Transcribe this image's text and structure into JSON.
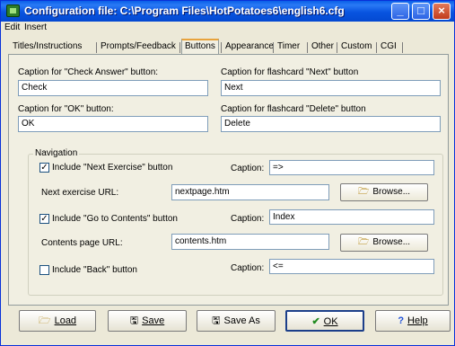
{
  "window": {
    "title": "Configuration file: C:\\Program Files\\HotPotatoes6\\english6.cfg",
    "minimize_glyph": "_",
    "maximize_glyph": "□",
    "close_glyph": "×"
  },
  "menu": {
    "items": [
      "Edit",
      "Insert"
    ]
  },
  "tabs": [
    "Titles/Instructions",
    "Prompts/Feedback",
    "Buttons",
    "Appearance",
    "Timer",
    "Other",
    "Custom",
    "CGI"
  ],
  "active_tab": "Buttons",
  "buttons_tab": {
    "check_label": "Caption for \"Check Answer\" button:",
    "check_value": "Check",
    "next_card_label": "Caption for flashcard \"Next\" button",
    "next_card_value": "Next",
    "ok_label": "Caption for \"OK\" button:",
    "ok_value": "OK",
    "delete_card_label": "Caption for flashcard \"Delete\" button",
    "delete_card_value": "Delete"
  },
  "navigation": {
    "legend": "Navigation",
    "next_exercise": {
      "checkbox_label": "Include \"Next Exercise\" button",
      "checked": true,
      "caption_label": "Caption:",
      "caption_value": "=>",
      "url_label": "Next exercise URL:",
      "url_value": "nextpage.htm",
      "browse_label": "Browse..."
    },
    "contents": {
      "checkbox_label": "Include \"Go to Contents\" button",
      "checked": true,
      "caption_label": "Caption:",
      "caption_value": "Index",
      "url_label": "Contents page URL:",
      "url_value": "contents.htm",
      "browse_label": "Browse..."
    },
    "back": {
      "checkbox_label": "Include \"Back\" button",
      "checked": false,
      "caption_label": "Caption:",
      "caption_value": "<="
    }
  },
  "footer": {
    "load_label": "Load",
    "save_label": "Save",
    "save_as_label": "Save As",
    "ok_label": "OK",
    "help_label": "Help"
  },
  "colors": {
    "title_bar": "#0a5fe8",
    "window_face": "#ece9d8",
    "ok_check": "#1f8a1f",
    "help_icon": "#1d4fd8",
    "active_tab_accent": "#e8a33c"
  },
  "icons": {
    "app": "hot-potatoes-icon",
    "browse": "folder-icon",
    "load": "folder-icon",
    "save": "floppy-disk-icon",
    "save_as": "floppy-disk-icon",
    "ok": "checkmark-icon",
    "help": "question-mark-icon"
  }
}
